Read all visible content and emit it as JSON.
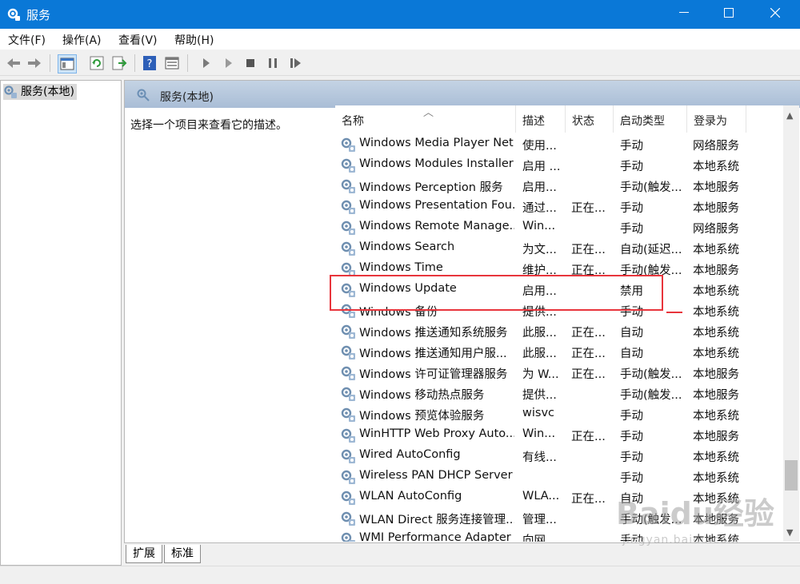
{
  "window": {
    "title": "服务",
    "controls": [
      "minimize",
      "maximize",
      "close"
    ]
  },
  "menu": [
    "文件(F)",
    "操作(A)",
    "查看(V)",
    "帮助(H)"
  ],
  "toolbar_icons": [
    "back-arrow-icon",
    "forward-arrow-icon",
    "console-tree-icon",
    "refresh-icon",
    "export-list-icon",
    "help-icon",
    "properties-icon",
    "start-service-icon",
    "start-paused-icon",
    "stop-service-icon",
    "pause-service-icon",
    "restart-service-icon"
  ],
  "tree": {
    "root_label": "服务(本地)"
  },
  "panel": {
    "header": "服务(本地)",
    "description": "选择一个项目来查看它的描述。"
  },
  "columns": [
    "名称",
    "描述",
    "状态",
    "启动类型",
    "登录为"
  ],
  "services": [
    {
      "name": "Windows Media Player Net...",
      "desc": "使用...",
      "status": "",
      "startup": "手动",
      "logon": "网络服务"
    },
    {
      "name": "Windows Modules Installer",
      "desc": "启用 ...",
      "status": "",
      "startup": "手动",
      "logon": "本地系统"
    },
    {
      "name": "Windows Perception 服务",
      "desc": "启用...",
      "status": "",
      "startup": "手动(触发...",
      "logon": "本地服务"
    },
    {
      "name": "Windows Presentation Fou...",
      "desc": "通过...",
      "status": "正在...",
      "startup": "手动",
      "logon": "本地服务"
    },
    {
      "name": "Windows Remote Manage...",
      "desc": "Win...",
      "status": "",
      "startup": "手动",
      "logon": "网络服务"
    },
    {
      "name": "Windows Search",
      "desc": "为文...",
      "status": "正在...",
      "startup": "自动(延迟...",
      "logon": "本地系统"
    },
    {
      "name": "Windows Time",
      "desc": "维护...",
      "status": "正在...",
      "startup": "手动(触发...",
      "logon": "本地服务"
    },
    {
      "name": "Windows Update",
      "desc": "启用...",
      "status": "",
      "startup": "禁用",
      "logon": "本地系统"
    },
    {
      "name": "Windows 备份",
      "desc": "提供...",
      "status": "",
      "startup": "手动",
      "logon": "本地系统"
    },
    {
      "name": "Windows 推送通知系统服务",
      "desc": "此服...",
      "status": "正在...",
      "startup": "自动",
      "logon": "本地系统"
    },
    {
      "name": "Windows 推送通知用户服...",
      "desc": "此服...",
      "status": "正在...",
      "startup": "自动",
      "logon": "本地系统"
    },
    {
      "name": "Windows 许可证管理器服务",
      "desc": "为 W...",
      "status": "正在...",
      "startup": "手动(触发...",
      "logon": "本地服务"
    },
    {
      "name": "Windows 移动热点服务",
      "desc": "提供...",
      "status": "",
      "startup": "手动(触发...",
      "logon": "本地服务"
    },
    {
      "name": "Windows 预览体验服务",
      "desc": "wisvc",
      "status": "",
      "startup": "手动",
      "logon": "本地系统"
    },
    {
      "name": "WinHTTP Web Proxy Auto...",
      "desc": "Win...",
      "status": "正在...",
      "startup": "手动",
      "logon": "本地服务"
    },
    {
      "name": "Wired AutoConfig",
      "desc": "有线...",
      "status": "",
      "startup": "手动",
      "logon": "本地系统"
    },
    {
      "name": "Wireless PAN DHCP Server",
      "desc": "",
      "status": "",
      "startup": "手动",
      "logon": "本地系统"
    },
    {
      "name": "WLAN AutoConfig",
      "desc": "WLA...",
      "status": "正在...",
      "startup": "自动",
      "logon": "本地系统"
    },
    {
      "name": "WLAN Direct 服务连接管理...",
      "desc": "管理...",
      "status": "",
      "startup": "手动(触发...",
      "logon": "本地服务"
    },
    {
      "name": "WMI Performance Adapter",
      "desc": "向网...",
      "status": "",
      "startup": "手动",
      "logon": "本地系统"
    }
  ],
  "tabs": [
    "扩展",
    "标准"
  ],
  "highlighted_service": "Windows Update",
  "watermark": {
    "main": "Baidu经验",
    "sub": "jingyan.baidu.com"
  },
  "colors": {
    "titlebar": "#0a78d7",
    "highlight": "#e8353c"
  }
}
